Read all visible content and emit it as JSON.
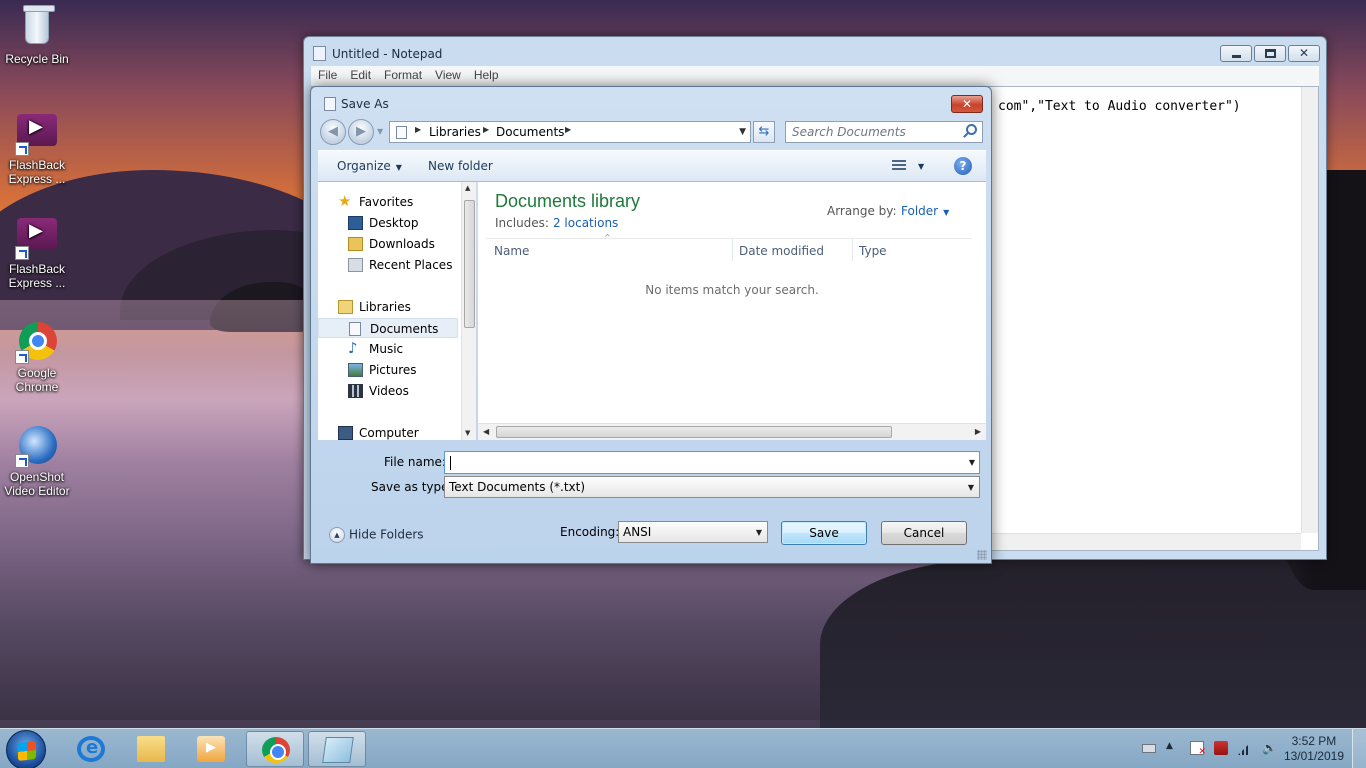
{
  "desktop": {
    "icons": [
      {
        "label": "Recycle Bin"
      },
      {
        "label": "FlashBack Express ..."
      },
      {
        "label": "FlashBack Express ..."
      },
      {
        "label": "Google Chrome"
      },
      {
        "label": "OpenShot Video Editor"
      }
    ]
  },
  "notepad": {
    "title": "Untitled - Notepad",
    "menu": [
      "File",
      "Edit",
      "Format",
      "View",
      "Help"
    ],
    "text": "com\",\"Text to Audio converter\")"
  },
  "dialog": {
    "title": "Save As",
    "close_label": "✕",
    "breadcrumbs": [
      "Libraries",
      "Documents"
    ],
    "search_placeholder": "Search Documents",
    "toolbar": {
      "organize": "Organize",
      "new_folder": "New folder",
      "help": "?"
    },
    "nav": {
      "favorites": "Favorites",
      "desktop": "Desktop",
      "downloads": "Downloads",
      "recent_places": "Recent Places",
      "libraries": "Libraries",
      "documents": "Documents",
      "music": "Music",
      "pictures": "Pictures",
      "videos": "Videos",
      "computer": "Computer"
    },
    "library": {
      "title": "Documents library",
      "includes_label": "Includes:",
      "includes_link": "2 locations",
      "arrange_label": "Arrange by:",
      "arrange_value": "Folder"
    },
    "columns": [
      "Name",
      "Date modified",
      "Type"
    ],
    "empty_message": "No items match your search.",
    "file_name_label": "File name:",
    "file_name_value": "",
    "save_type_label": "Save as type:",
    "save_type_value": "Text Documents (*.txt)",
    "hide_folders": "Hide Folders",
    "encoding_label": "Encoding:",
    "encoding_value": "ANSI",
    "save_label": "Save",
    "cancel_label": "Cancel"
  },
  "taskbar": {
    "time": "3:52 PM",
    "date": "13/01/2019"
  }
}
